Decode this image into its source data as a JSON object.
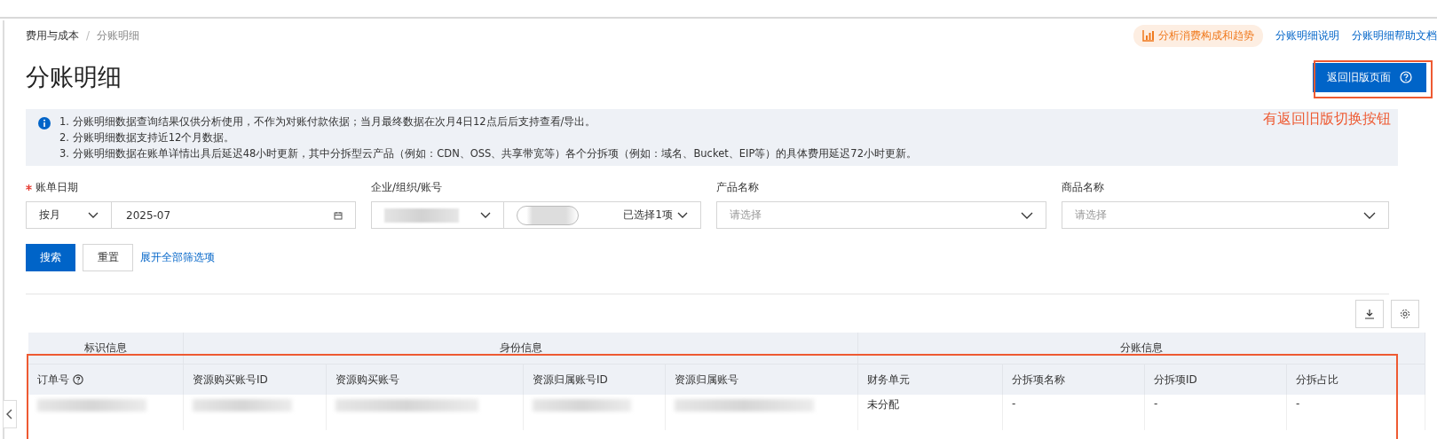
{
  "breadcrumb": {
    "separator": "/",
    "items": [
      {
        "label": "费用与成本"
      },
      {
        "label": "分账明细"
      }
    ]
  },
  "header_links": {
    "analysis_button": "分析消费构成和趋势",
    "links": [
      "分账明细说明",
      "分账明细帮助文档"
    ]
  },
  "title": "分账明细",
  "old_version_button": {
    "label": "返回旧版页面"
  },
  "annotation": {
    "text": "有返回旧版切换按钮"
  },
  "notice": {
    "lines": [
      "1. 分账明细数据查询结果仅供分析使用，不作为对账付款依据；当月最终数据在次月4日12点后后支持查看/导出。",
      "2. 分账明细数据支持近12个月数据。",
      "3. 分账明细数据在账单详情出具后延迟48小时更新，其中分拆型云产品（例如：CDN、OSS、共享带宽等）各个分拆项（例如：域名、Bucket、EIP等）的具体费用延迟72小时更新。"
    ]
  },
  "filters": [
    {
      "label": "账单日期",
      "required": true,
      "kind": "period",
      "period": "按月",
      "value": "2025-07"
    },
    {
      "label": "企业/组织/账号",
      "required": false,
      "kind": "account",
      "summary": "已选择1项"
    },
    {
      "label": "产品名称",
      "required": false,
      "kind": "select",
      "placeholder": "请选择"
    },
    {
      "label": "商品名称",
      "required": false,
      "kind": "select",
      "placeholder": "请选择"
    }
  ],
  "actions": {
    "search": "搜索",
    "reset": "重置",
    "expand": "展开全部筛选项"
  },
  "table": {
    "groups": [
      {
        "label": "标识信息",
        "columns": [
          {
            "label": "订单号",
            "help": true
          }
        ]
      },
      {
        "label": "身份信息",
        "columns": [
          {
            "label": "资源购买账号ID",
            "help": false
          },
          {
            "label": "资源购买账号",
            "help": false
          },
          {
            "label": "资源归属账号ID",
            "help": false
          },
          {
            "label": "资源归属账号",
            "help": false
          }
        ]
      },
      {
        "label": "分账信息",
        "columns": [
          {
            "label": "财务单元",
            "help": false
          },
          {
            "label": "分拆项名称",
            "help": false
          },
          {
            "label": "分拆项ID",
            "help": false
          },
          {
            "label": "分拆占比",
            "help": false
          }
        ]
      }
    ],
    "rows": [
      {
        "cells": [
          {
            "kind": "redacted"
          },
          {
            "kind": "redacted"
          },
          {
            "kind": "redacted"
          },
          {
            "kind": "redacted"
          },
          {
            "kind": "redacted"
          },
          {
            "kind": "text",
            "text": "未分配"
          },
          {
            "kind": "text",
            "text": "-"
          },
          {
            "kind": "text",
            "text": "-"
          },
          {
            "kind": "text",
            "text": "-"
          }
        ]
      }
    ]
  }
}
